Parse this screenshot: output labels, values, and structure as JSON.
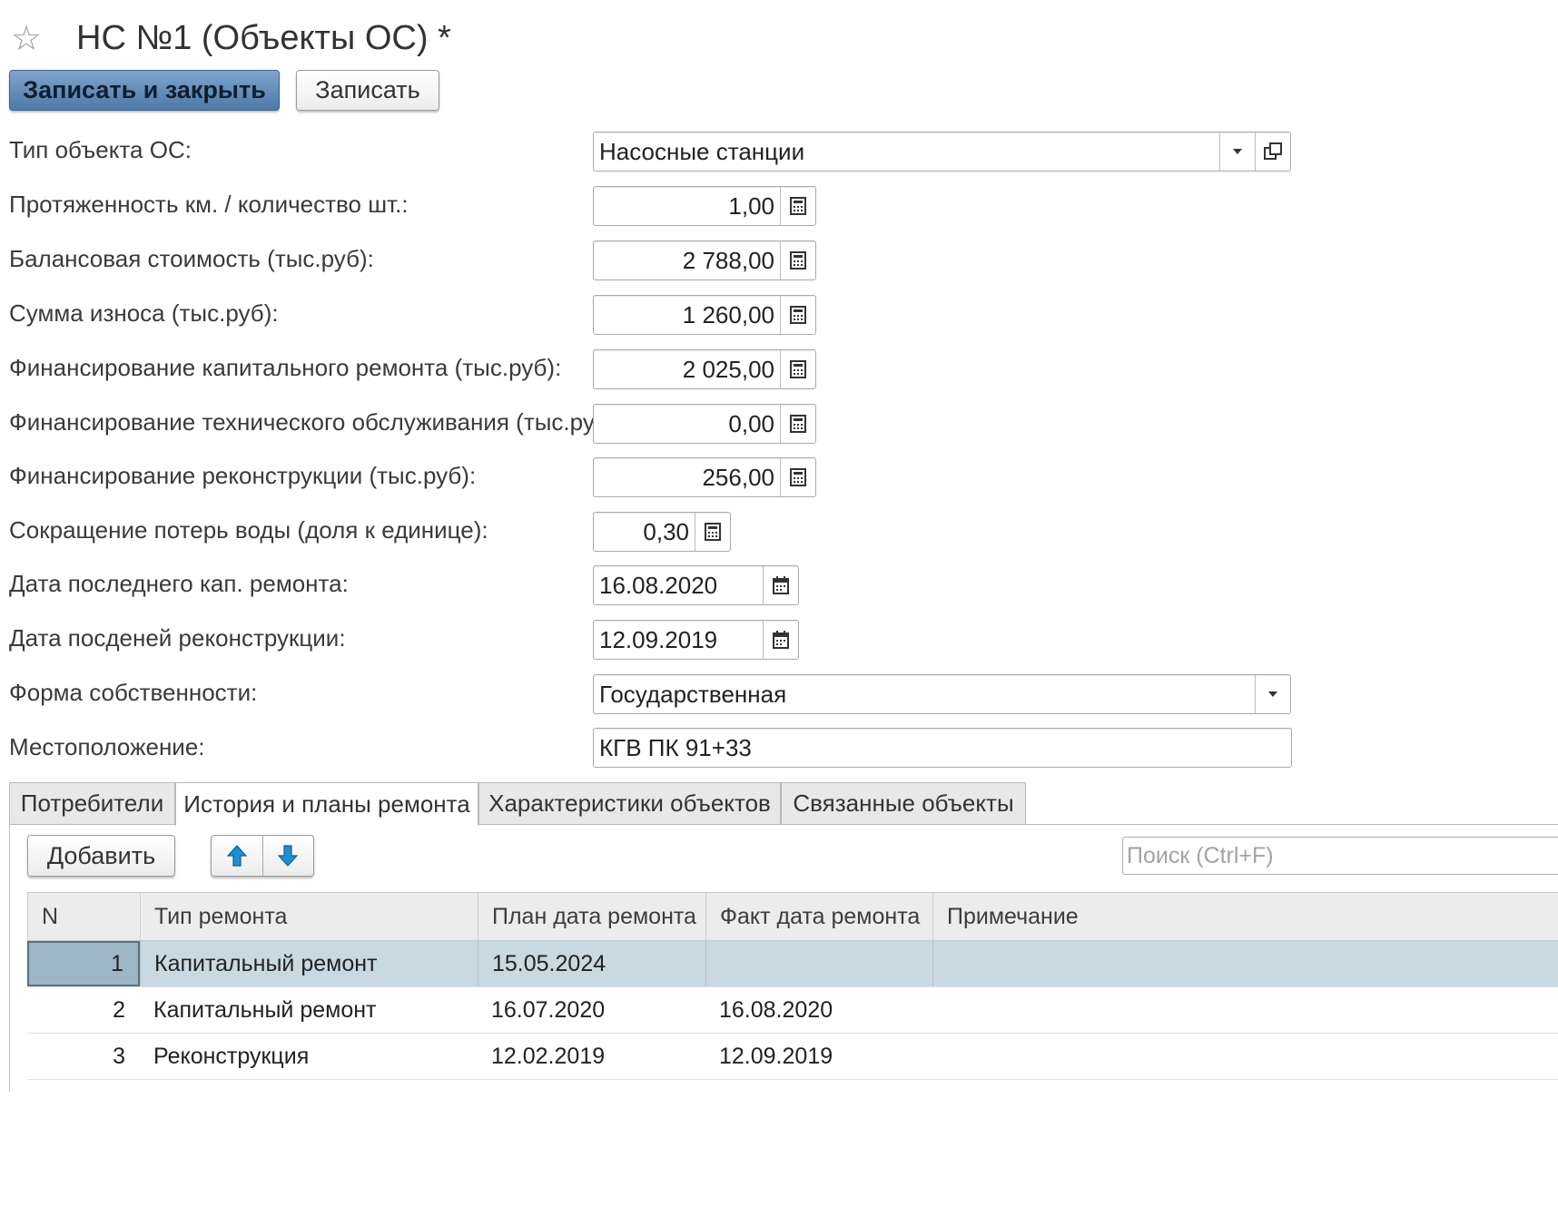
{
  "header": {
    "title": "НС №1 (Объекты ОС) *",
    "star_icon": "star-icon"
  },
  "toolbar": {
    "save_close_label": "Записать и закрыть",
    "save_label": "Записать"
  },
  "form": {
    "object_type": {
      "label": "Тип объекта ОС:",
      "value": "Насосные станции"
    },
    "length_count": {
      "label": "Протяженность км. / количество шт.:",
      "value": "1,00"
    },
    "balance_cost": {
      "label": "Балансовая стоимость (тыс.руб):",
      "value": "2 788,00"
    },
    "depreciation": {
      "label": "Сумма износа (тыс.руб):",
      "value": "1 260,00"
    },
    "capital_repair_funding": {
      "label": "Финансирование капитального ремонта (тыс.руб):",
      "value": "2 025,00"
    },
    "maintenance_funding": {
      "label": "Финансирование технического обслуживания (тыс.руб):",
      "value": "0,00"
    },
    "reconstruction_funding": {
      "label": "Финансирование реконструкции (тыс.руб):",
      "value": "256,00"
    },
    "water_loss_reduction": {
      "label": "Сокращение потерь воды (доля к единице):",
      "value": "0,30"
    },
    "last_capital_repair_date": {
      "label": "Дата последнего кап. ремонта:",
      "value": "16.08.2020"
    },
    "last_reconstruction_date": {
      "label": "Дата посденей реконструкции:",
      "value": "12.09.2019"
    },
    "ownership_form": {
      "label": "Форма собственности:",
      "value": "Государственная"
    },
    "location": {
      "label": "Местоположение:",
      "value": "КГВ  ПК 91+33"
    }
  },
  "tabs": [
    {
      "label": "Потребители",
      "active": false
    },
    {
      "label": "История и планы ремонта",
      "active": true
    },
    {
      "label": "Характеристики объектов",
      "active": false
    },
    {
      "label": "Связанные объекты",
      "active": false
    }
  ],
  "repairs": {
    "add_label": "Добавить",
    "search_placeholder": "Поиск (Ctrl+F)",
    "columns": [
      "N",
      "Тип ремонта",
      "План дата ремонта",
      "Факт дата ремонта",
      "Примечание"
    ],
    "rows": [
      {
        "n": "1",
        "type": "Капитальный ремонт",
        "plan": "15.05.2024",
        "fact": "",
        "note": "",
        "selected": true
      },
      {
        "n": "2",
        "type": "Капитальный ремонт",
        "plan": "16.07.2020",
        "fact": "16.08.2020",
        "note": "",
        "selected": false
      },
      {
        "n": "3",
        "type": "Реконструкция",
        "plan": "12.02.2019",
        "fact": "12.09.2019",
        "note": "",
        "selected": false
      }
    ]
  },
  "colors": {
    "primary_button": "#5a86b3",
    "selected_row": "#c9d9e1",
    "arrow_icon": "#1f8fd4"
  }
}
